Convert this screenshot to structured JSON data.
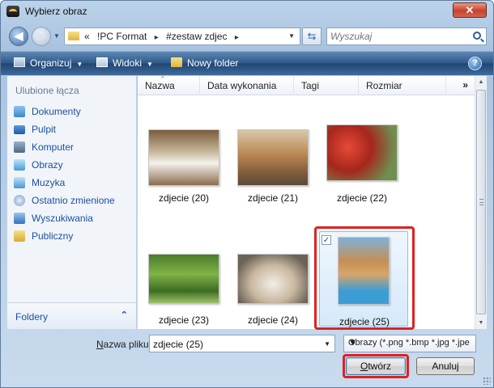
{
  "window": {
    "title": "Wybierz obraz",
    "close_label": "✕"
  },
  "address": {
    "prefix": "«",
    "crumbs": [
      "!PC Format",
      "#zestaw zdjec"
    ],
    "separator": "▸",
    "refresh_icon": "refresh-icon"
  },
  "search": {
    "placeholder": "Wyszukaj"
  },
  "toolbar": {
    "organize": "Organizuj",
    "views": "Widoki",
    "new_folder": "Nowy folder",
    "help": "?"
  },
  "nav": {
    "heading": "Ulubione łącza",
    "items": [
      {
        "label": "Dokumenty",
        "icon": "documents-icon"
      },
      {
        "label": "Pulpit",
        "icon": "desktop-icon"
      },
      {
        "label": "Komputer",
        "icon": "computer-icon"
      },
      {
        "label": "Obrazy",
        "icon": "pictures-icon"
      },
      {
        "label": "Muzyka",
        "icon": "music-icon"
      },
      {
        "label": "Ostatnio zmienione",
        "icon": "recent-icon"
      },
      {
        "label": "Wyszukiwania",
        "icon": "searches-icon"
      },
      {
        "label": "Publiczny",
        "icon": "public-folder-icon"
      }
    ],
    "folders_label": "Foldery"
  },
  "columns": [
    "Nazwa",
    "Data wykonania",
    "Tagi",
    "Rozmiar"
  ],
  "columns_more": "»",
  "files": [
    {
      "name": "zdjecie (20)",
      "selected": false
    },
    {
      "name": "zdjecie (21)",
      "selected": false
    },
    {
      "name": "zdjecie (22)",
      "selected": false
    },
    {
      "name": "zdjecie (23)",
      "selected": false
    },
    {
      "name": "zdjecie (24)",
      "selected": false
    },
    {
      "name": "zdjecie (25)",
      "selected": true
    }
  ],
  "footer": {
    "filename_label_accel": "N",
    "filename_label_rest": "azwa pliku:",
    "filename_value": "zdjecie (25)",
    "filetype": "Obrazy (*.png *.bmp *.jpg *.jpe",
    "open_accel": "O",
    "open_rest": "twórz",
    "cancel": "Anuluj"
  },
  "colors": {
    "highlight": "#e02020",
    "link": "#1d4fa0",
    "toolbar": "#2d5786"
  }
}
